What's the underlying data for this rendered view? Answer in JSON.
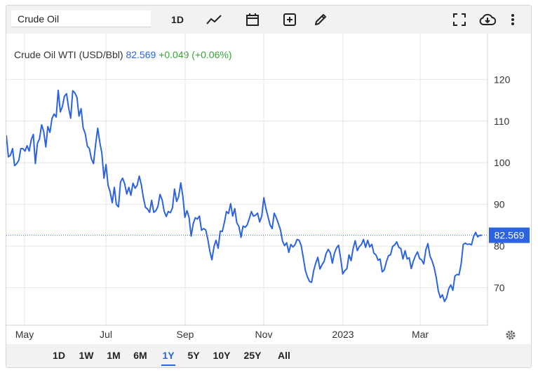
{
  "toolbar": {
    "search_value": "Crude Oil",
    "interval_label": "1D",
    "icons": [
      "line-chart-icon",
      "calendar-icon",
      "add-box-icon",
      "pencil-icon",
      "fullscreen-icon",
      "cloud-download-icon",
      "more-vert-icon"
    ]
  },
  "legend": {
    "name": "Crude Oil WTI (USD/Bbl)",
    "price": "82.569",
    "change": "+0.049 (+0.06%)"
  },
  "last_price_label": "82.569",
  "ranges": [
    {
      "label": "1D"
    },
    {
      "label": "1W"
    },
    {
      "label": "1M"
    },
    {
      "label": "6M"
    },
    {
      "label": "1Y",
      "active": true
    },
    {
      "label": "5Y"
    },
    {
      "label": "10Y"
    },
    {
      "label": "25Y"
    },
    {
      "label": "All"
    }
  ],
  "colors": {
    "line": "#2c63e0",
    "accent": "#2c63e0",
    "up": "#37a337",
    "grid": "#e6e6e6"
  },
  "chart_data": {
    "type": "line",
    "title": "Crude Oil WTI (USD/Bbl)",
    "xlabel": "",
    "ylabel": "",
    "x_tick_labels": [
      "May",
      "Jul",
      "Sep",
      "Nov",
      "2023",
      "Mar"
    ],
    "y_tick_labels": [
      "70",
      "80",
      "90",
      "100",
      "110",
      "120"
    ],
    "ylim": [
      61,
      131
    ],
    "grid": true,
    "series": [
      {
        "name": "Crude Oil WTI (USD/Bbl)",
        "values": [
          106.6,
          101.4,
          101.8,
          103.4,
          99.3,
          99.8,
          100.6,
          103.4,
          103.4,
          102.8,
          104.1,
          102.8,
          105.5,
          106.8,
          99.8,
          104.7,
          105.8,
          109.1,
          107.5,
          103.8,
          108.7,
          107.3,
          110.6,
          111.7,
          111.0,
          117.4,
          112.2,
          113.5,
          116.0,
          116.6,
          113.2,
          110.7,
          117.3,
          116.8,
          115.7,
          111.2,
          113.0,
          108.4,
          107.0,
          104.0,
          103.4,
          100.9,
          99.8,
          104.4,
          108.3,
          105.0,
          102.3,
          96.3,
          99.6,
          94.6,
          93.0,
          90.4,
          94.1,
          90.0,
          89.4,
          95.4,
          96.3,
          94.9,
          92.5,
          94.1,
          92.2,
          95.1,
          93.9,
          94.6,
          96.8,
          94.8,
          91.6,
          89.3,
          88.9,
          88.1,
          91.0,
          88.1,
          88.5,
          89.5,
          92.4,
          91.1,
          88.4,
          87.1,
          88.3,
          88.0,
          89.2,
          93.7,
          90.7,
          91.9,
          95.2,
          91.9,
          86.9,
          88.5,
          86.9,
          82.4,
          85.4,
          86.8,
          86.5,
          87.2,
          83.8,
          84.2,
          83.9,
          81.7,
          78.8,
          76.7,
          79.9,
          81.4,
          79.5,
          83.6,
          83.5,
          85.7,
          88.3,
          87.8,
          90.2,
          87.2,
          89.0,
          85.6,
          84.7,
          82.1,
          84.8,
          84.5,
          85.1,
          86.6,
          88.3,
          87.2,
          87.4,
          87.9,
          85.8,
          87.2,
          91.6,
          89.0,
          87.1,
          85.1,
          84.2,
          87.9,
          86.8,
          85.4,
          83.9,
          81.2,
          80.1,
          80.8,
          78.5,
          80.4,
          79.8,
          80.3,
          81.6,
          81.4,
          80.1,
          77.2,
          74.2,
          72.6,
          71.5,
          71.3,
          74.1,
          75.9,
          77.3,
          74.5,
          75.5,
          76.3,
          78.2,
          79.2,
          78.4,
          75.9,
          78.3,
          79.6,
          80.2,
          77.0,
          73.3,
          74.1,
          74.6,
          77.9,
          76.5,
          79.4,
          81.3,
          78.9,
          79.9,
          80.4,
          81.6,
          79.7,
          81.4,
          79.8,
          80.4,
          78.3,
          77.9,
          76.6,
          76.9,
          73.8,
          74.3,
          76.2,
          77.7,
          77.9,
          79.9,
          80.3,
          81.0,
          79.7,
          79.4,
          76.9,
          78.9,
          76.9,
          77.2,
          74.6,
          76.4,
          77.7,
          78.6,
          77.0,
          76.7,
          75.7,
          79.1,
          80.6,
          77.6,
          76.5,
          74.9,
          72.5,
          69.3,
          67.6,
          68.3,
          66.7,
          67.6,
          69.7,
          70.7,
          69.4,
          72.8,
          73.2,
          73.1,
          75.7,
          80.4,
          80.7,
          80.4,
          80.5,
          80.3,
          82.3,
          83.3,
          82.2,
          82.6,
          82.6
        ]
      }
    ]
  }
}
